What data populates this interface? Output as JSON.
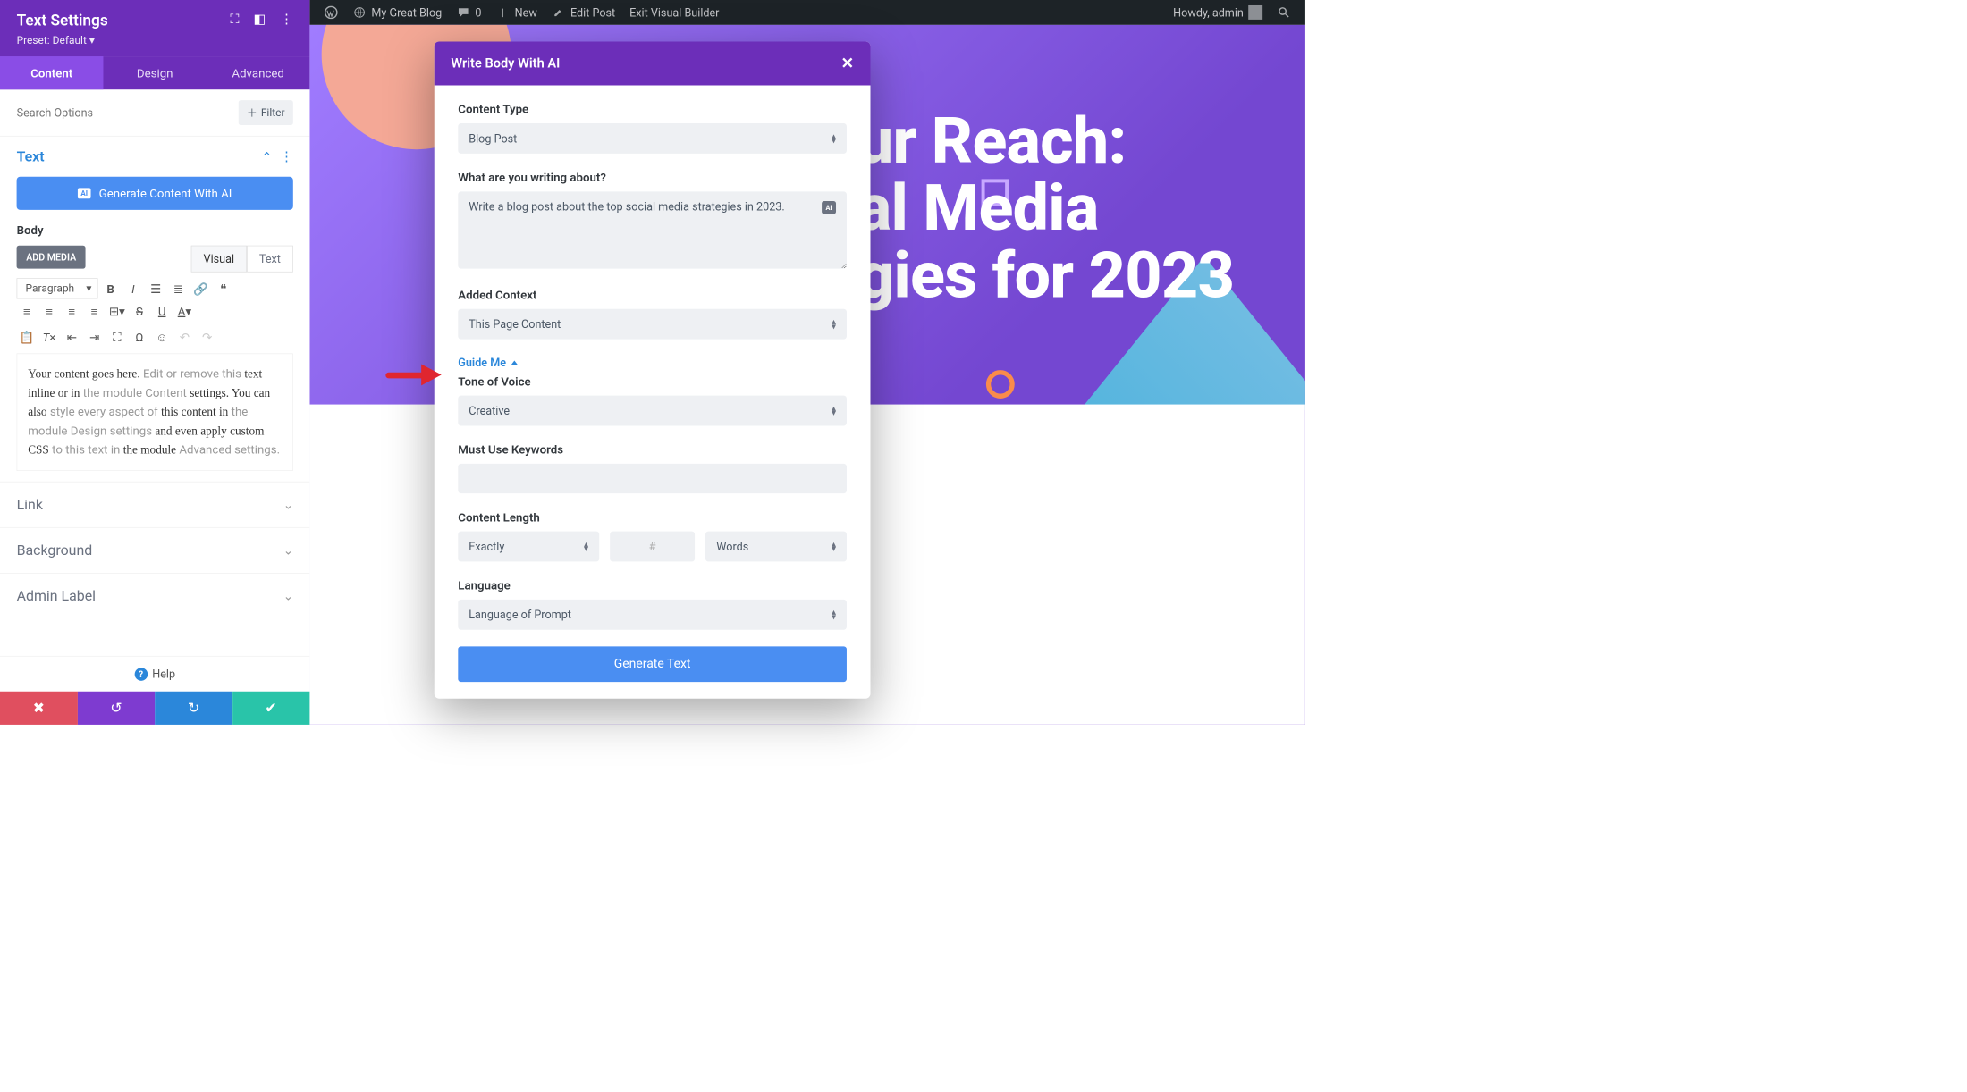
{
  "wpbar": {
    "site": "My Great Blog",
    "comments": "0",
    "new": "New",
    "edit": "Edit Post",
    "exit": "Exit Visual Builder",
    "howdy": "Howdy, admin"
  },
  "panel": {
    "title": "Text Settings",
    "preset": "Preset: Default",
    "tabs": [
      "Content",
      "Design",
      "Advanced"
    ],
    "search_ph": "Search Options",
    "filter": "Filter",
    "section": "Text",
    "generate": "Generate Content With AI",
    "body": "Body",
    "add_media": "ADD MEDIA",
    "ed_tabs": [
      "Visual",
      "Text"
    ],
    "para": "Paragraph",
    "content_plain": "Your content goes here. Edit or remove this text inline or in the module Content settings. You can also style every aspect of this content in the module Design settings and even apply custom CSS to this text in the module Advanced settings.",
    "accordions": [
      "Link",
      "Background",
      "Admin Label"
    ],
    "help": "Help"
  },
  "hero": {
    "line1": "ur Reach:",
    "line2": "al Media",
    "line3": "gies for 2023"
  },
  "modal": {
    "title": "Write Body With AI",
    "content_type_lbl": "Content Type",
    "content_type": "Blog Post",
    "about_lbl": "What are you writing about?",
    "about_val": "Write a blog post about the top social media strategies in 2023.",
    "context_lbl": "Added Context",
    "context": "This Page Content",
    "guide": "Guide Me",
    "tone_lbl": "Tone of Voice",
    "tone": "Creative",
    "keywords_lbl": "Must Use Keywords",
    "length_lbl": "Content Length",
    "length_mode": "Exactly",
    "length_num": "#",
    "length_unit": "Words",
    "lang_lbl": "Language",
    "lang": "Language of Prompt",
    "generate": "Generate Text"
  }
}
